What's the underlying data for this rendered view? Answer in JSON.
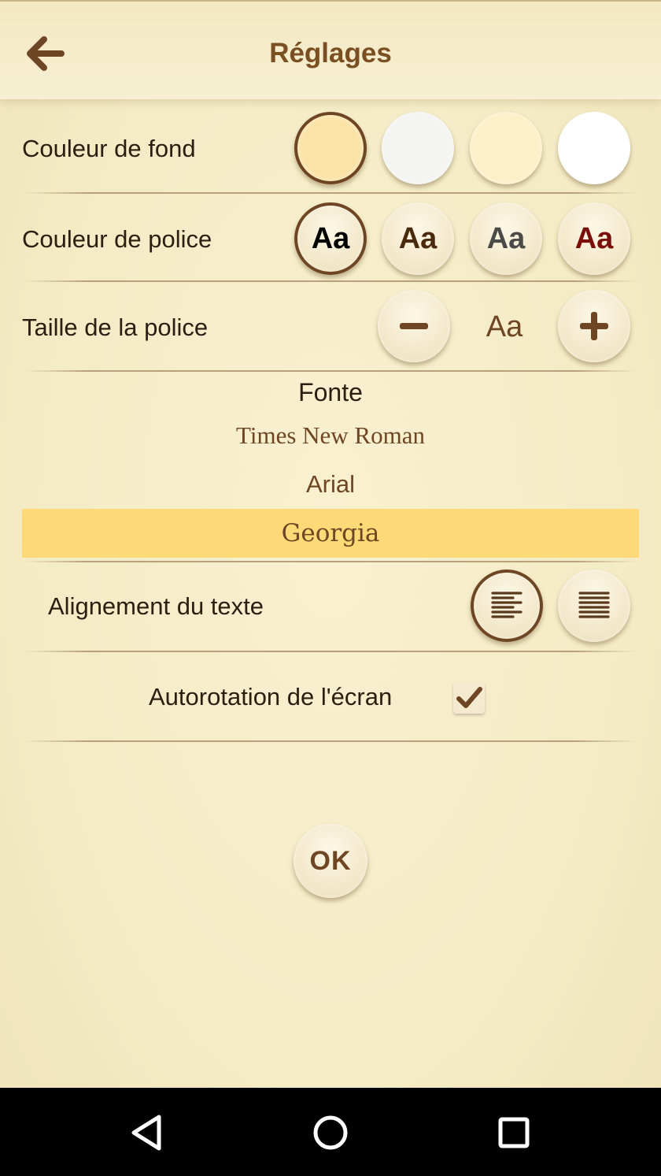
{
  "header": {
    "title": "Réglages",
    "back_icon": "arrow-left-icon"
  },
  "background_color": {
    "label": "Couleur de fond",
    "options": [
      {
        "color": "#fbe3a8",
        "selected": true
      },
      {
        "color": "#f4f4f2",
        "selected": false
      },
      {
        "color": "#fdefc8",
        "selected": false
      },
      {
        "color": "#ffffff",
        "selected": false
      }
    ]
  },
  "font_color": {
    "label": "Couleur de police",
    "options": [
      {
        "text": "Aa",
        "color": "#000000",
        "selected": true
      },
      {
        "text": "Aa",
        "color": "#4a2a0c",
        "selected": false
      },
      {
        "text": "Aa",
        "color": "#4b4a48",
        "selected": false
      },
      {
        "text": "Aa",
        "color": "#7a0f0a",
        "selected": false
      }
    ]
  },
  "font_size": {
    "label": "Taille de la police",
    "minus_icon": "minus-icon",
    "preview": "Aa",
    "plus_icon": "plus-icon"
  },
  "font_family": {
    "title": "Fonte",
    "options": [
      {
        "label": "Times New Roman",
        "selected": false
      },
      {
        "label": "Arial",
        "selected": false
      },
      {
        "label": "Georgia",
        "selected": true
      }
    ]
  },
  "alignment": {
    "label": "Alignement du texte",
    "options": [
      "align-left-icon",
      "align-justify-icon"
    ],
    "selected": 0
  },
  "autorotation": {
    "label": "Autorotation de l'écran",
    "checked": true
  },
  "ok_button": {
    "label": "OK"
  },
  "nav": {
    "back": "back-triangle-icon",
    "home": "home-circle-icon",
    "recents": "recents-square-icon"
  },
  "colors": {
    "accent_brown": "#6e4623",
    "selection_yellow": "#fdd977"
  }
}
